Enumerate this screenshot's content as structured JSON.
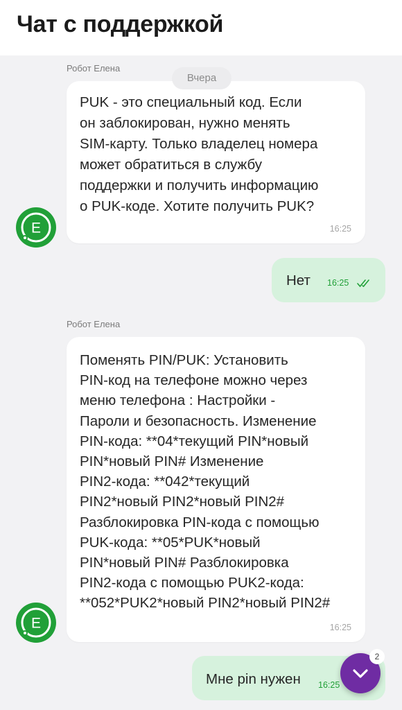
{
  "header": {
    "title": "Чат с поддержкой"
  },
  "messages": [
    {
      "sender": "Робот Елена",
      "date_separator": "Вчера",
      "text": "PUK - это специальный код. Если\nон заблокирован, нужно менять\nSIM-карту. Только владелец номера\nможет обратиться в службу\nподдержки и получить информацию\nо PUK-коде. Хотите получить PUK?",
      "time": "16:25"
    },
    {
      "outgoing": true,
      "text": "Нет",
      "time": "16:25",
      "status": "read"
    },
    {
      "sender": "Робот Елена",
      "text": "Поменять PIN/PUK: Установить\nPIN-код на телефоне можно через\nменю телефона : Настройки -\nПароли и безопасность. Изменение\nPIN-кода: **04*текущий PIN*новый\nPIN*новый PIN# Изменение\nPIN2-кода: **042*текущий\nPIN2*новый PIN2*новый PIN2#\nРазблокировка PIN-кода с помощью\nPUK-кода: **05*PUK*новый\nPIN*новый PIN# Разблокировка\nPIN2-кода с помощью PUK2-кода:\n**052*PUK2*новый PIN2*новый PIN2#",
      "time": "16:25"
    },
    {
      "outgoing": true,
      "text": "Мне pin нужен",
      "time": "16:25"
    }
  ],
  "avatar": {
    "letter": "E",
    "icon": "robot-elena-avatar-icon",
    "color": "#21a038"
  },
  "scroll_button": {
    "icon": "chevron-down-icon",
    "badge": "2",
    "color": "#6f2ca3"
  },
  "colors": {
    "accent": "#21a038",
    "outgoing_bubble": "#d6f2dd",
    "background": "#f2f2f4"
  }
}
